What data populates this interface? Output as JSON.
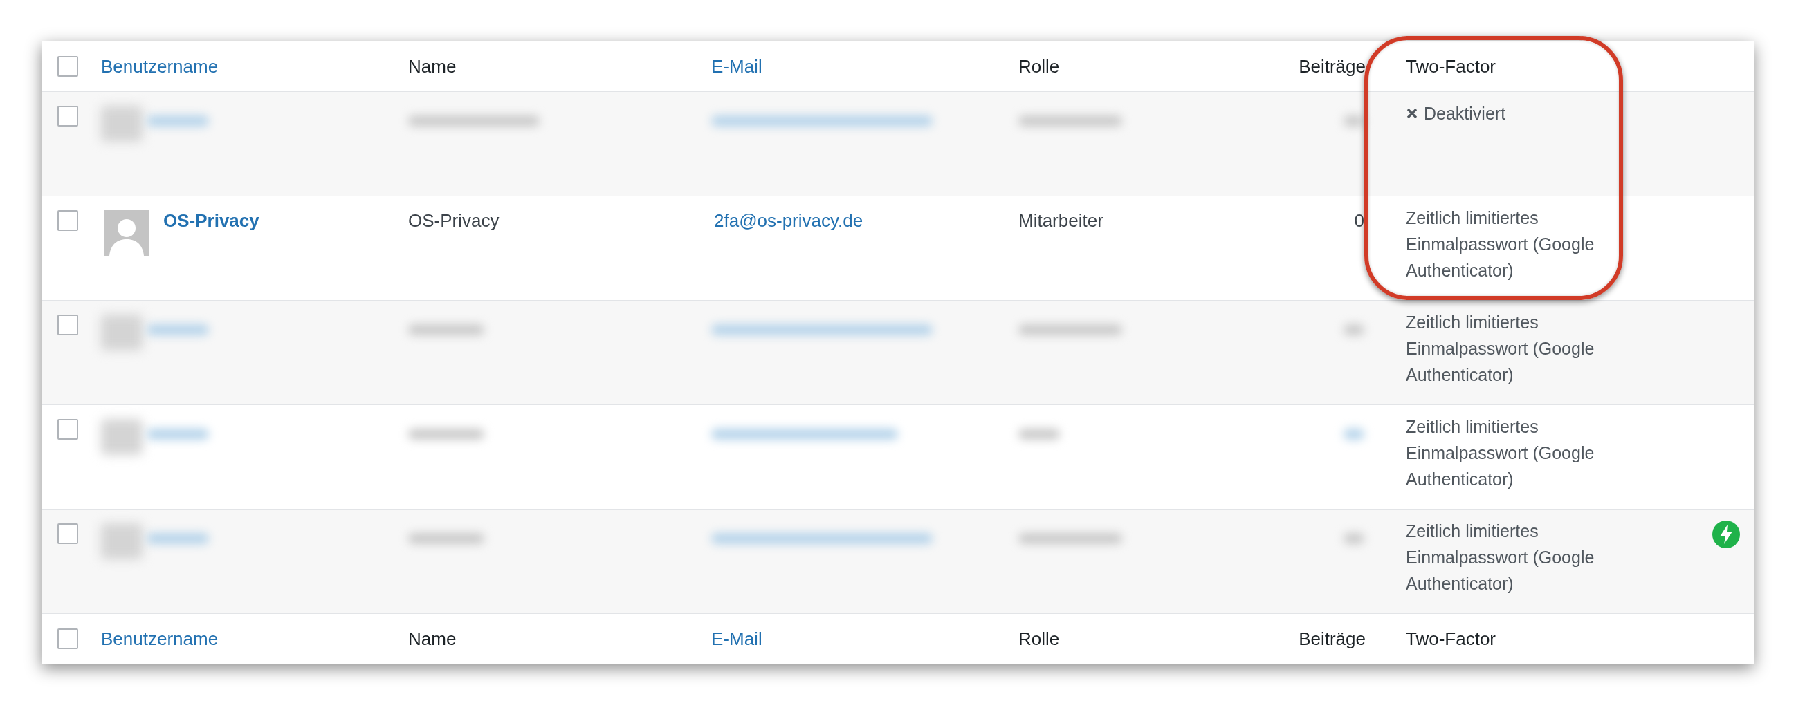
{
  "header_columns": [
    {
      "label": "Benutzername",
      "sortable": true
    },
    {
      "label": "Name",
      "sortable": false
    },
    {
      "label": "E-Mail",
      "sortable": true
    },
    {
      "label": "Rolle",
      "sortable": false
    },
    {
      "label": "Beiträge",
      "sortable": false
    },
    {
      "label": "Two-Factor",
      "sortable": false
    }
  ],
  "header_checked": false,
  "rows": [
    {
      "kind": "blurred",
      "checked": false,
      "two_factor": {
        "kind": "disabled",
        "text": "Deaktiviert"
      },
      "bolt_badge": false
    },
    {
      "kind": "user",
      "checked": false,
      "username": "OS-Privacy",
      "name": "OS-Privacy",
      "email": "2fa@os-privacy.de",
      "role": "Mitarbeiter",
      "posts": "0",
      "two_factor": {
        "kind": "method",
        "text": "Zeitlich limitiertes Einmalpasswort (Google Authenticator)"
      },
      "bolt_badge": false
    },
    {
      "kind": "blurred",
      "checked": false,
      "two_factor": {
        "kind": "method",
        "text": "Zeitlich limitiertes Einmalpasswort (Google Authenticator)"
      },
      "bolt_badge": false
    },
    {
      "kind": "blurred",
      "checked": false,
      "two_factor": {
        "kind": "method",
        "text": "Zeitlich limitiertes Einmalpasswort (Google Authenticator)"
      },
      "bolt_badge": false
    },
    {
      "kind": "blurred",
      "checked": false,
      "two_factor": {
        "kind": "method",
        "text": "Zeitlich limitiertes Einmalpasswort (Google Authenticator)"
      },
      "bolt_badge": true
    }
  ],
  "footer_checked": false,
  "footer_columns": [
    {
      "label": "Benutzername",
      "sortable": true
    },
    {
      "label": "Name",
      "sortable": false
    },
    {
      "label": "E-Mail",
      "sortable": true
    },
    {
      "label": "Rolle",
      "sortable": false
    },
    {
      "label": "Beiträge",
      "sortable": false
    },
    {
      "label": "Two-Factor",
      "sortable": false
    }
  ],
  "annotation": {
    "kind": "highlight"
  }
}
